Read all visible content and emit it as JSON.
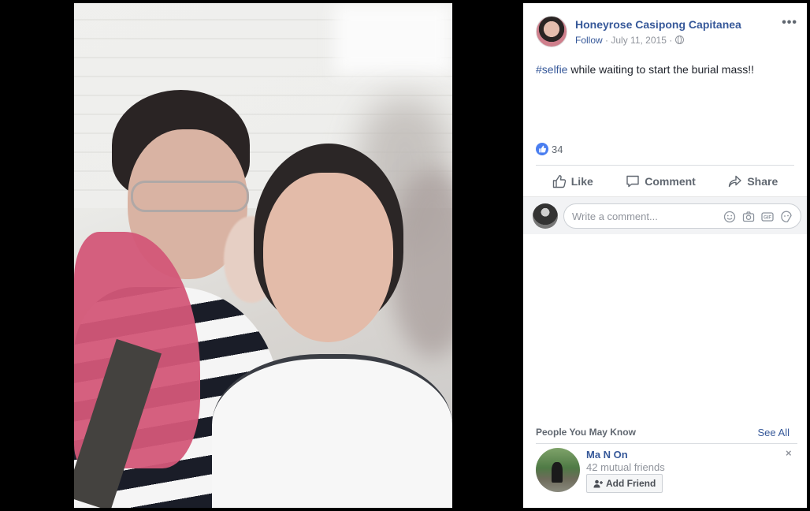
{
  "photo": {
    "alt_icon": "selfie-photo"
  },
  "post": {
    "author": "Honeyrose Casipong Capitanea",
    "follow_label": "Follow",
    "separator": "·",
    "date": "July 11, 2015",
    "privacy_icon": "globe-icon",
    "more_label": "•••",
    "hashtag": "#selfie",
    "text": " while waiting to start the burial mass!!",
    "reaction_count": "34"
  },
  "actions": {
    "like": "Like",
    "comment": "Comment",
    "share": "Share"
  },
  "comment_box": {
    "placeholder": "Write a comment..."
  },
  "pymk": {
    "title": "People You May Know",
    "see_all": "See All",
    "suggestion": {
      "name": "Ma N On",
      "mutual": "42 mutual friends",
      "add_label": "Add Friend"
    },
    "dismiss_label": "×"
  },
  "colors": {
    "link": "#365899",
    "like_blue": "#4a7ef0",
    "muted": "#90949c"
  }
}
